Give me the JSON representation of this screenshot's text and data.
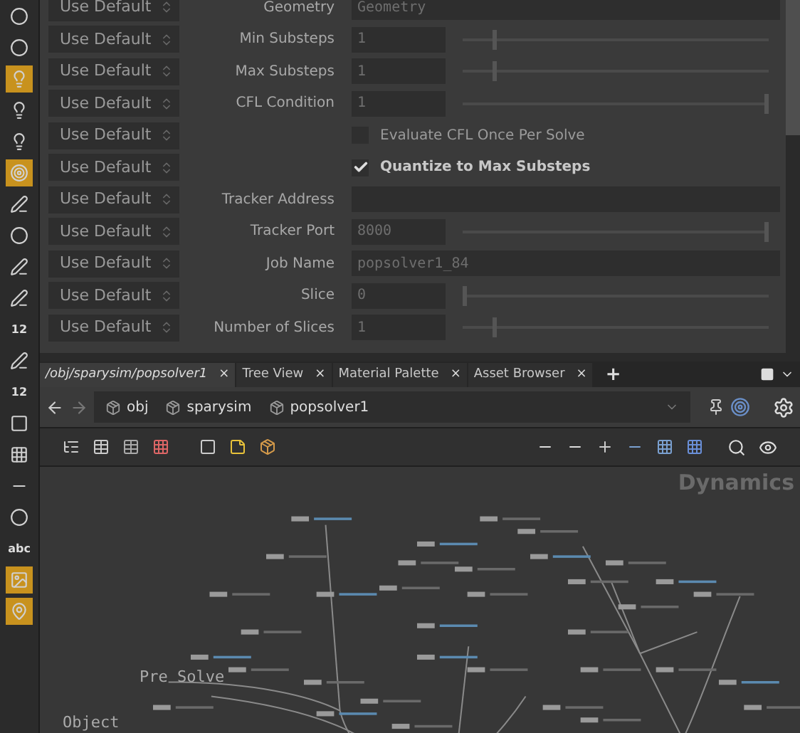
{
  "toolbar": [
    {
      "kind": "icon",
      "selected": false
    },
    {
      "kind": "icon",
      "selected": false
    },
    {
      "kind": "icon",
      "selected": true
    },
    {
      "kind": "icon",
      "selected": false
    },
    {
      "kind": "icon",
      "selected": false
    },
    {
      "kind": "icon",
      "selected": true
    },
    {
      "kind": "icon",
      "selected": false
    },
    {
      "kind": "icon",
      "selected": false
    },
    {
      "kind": "icon",
      "selected": false
    },
    {
      "kind": "icon",
      "selected": false
    },
    {
      "kind": "label",
      "label": "12",
      "selected": false
    },
    {
      "kind": "icon",
      "selected": false
    },
    {
      "kind": "label",
      "label": "12",
      "selected": false
    },
    {
      "kind": "icon",
      "selected": false
    },
    {
      "kind": "icon",
      "selected": false
    },
    {
      "kind": "icon",
      "selected": false
    },
    {
      "kind": "icon",
      "selected": false
    },
    {
      "kind": "label",
      "label": "abc",
      "selected": false
    },
    {
      "kind": "icon",
      "selected": true
    },
    {
      "kind": "icon",
      "selected": true
    }
  ],
  "parameters": [
    {
      "kind": "wide",
      "mode": "Use Default",
      "label": "Geometry",
      "value": "Geometry"
    },
    {
      "kind": "slider",
      "mode": "Use Default",
      "label": "Min Substeps",
      "value": "1",
      "level": 0.1
    },
    {
      "kind": "slider",
      "mode": "Use Default",
      "label": "Max Substeps",
      "value": "1",
      "level": 0.1
    },
    {
      "kind": "slider",
      "mode": "Use Default",
      "label": "CFL Condition",
      "value": "1",
      "level": 1
    },
    {
      "kind": "checkbox",
      "mode": "Use Default",
      "label": "Evaluate CFL Once Per Solve",
      "checked": false
    },
    {
      "kind": "checkbox",
      "mode": "Use Default",
      "label": "Quantize to Max Substeps",
      "checked": true
    },
    {
      "kind": "wide",
      "mode": "Use Default",
      "label": "Tracker Address"
    },
    {
      "kind": "slider",
      "mode": "Use Default",
      "label": "Tracker Port",
      "value": "8000",
      "level": 1
    },
    {
      "kind": "wide",
      "mode": "Use Default",
      "label": "Job Name",
      "value": "popsolver1_84"
    },
    {
      "kind": "slider",
      "mode": "Use Default",
      "label": "Slice",
      "value": "0",
      "level": 0
    },
    {
      "kind": "slider",
      "mode": "Use Default",
      "label": "Number of Slices",
      "value": "1",
      "level": 0.1
    }
  ],
  "tabs": [
    {
      "label": "/obj/sparysim/popsolver1",
      "close": "×",
      "selected": true
    },
    {
      "label": "Tree View",
      "close": "×",
      "selected": false
    },
    {
      "label": "Material Palette",
      "close": "×",
      "selected": false
    },
    {
      "label": "Asset Browser",
      "close": "×",
      "selected": false
    }
  ],
  "new_tab": "+",
  "path": [
    "obj",
    "sparysim",
    "popsolver1"
  ],
  "network": {
    "context": "Dynamics",
    "boxes": [
      "Pre Solve",
      "Object"
    ]
  }
}
